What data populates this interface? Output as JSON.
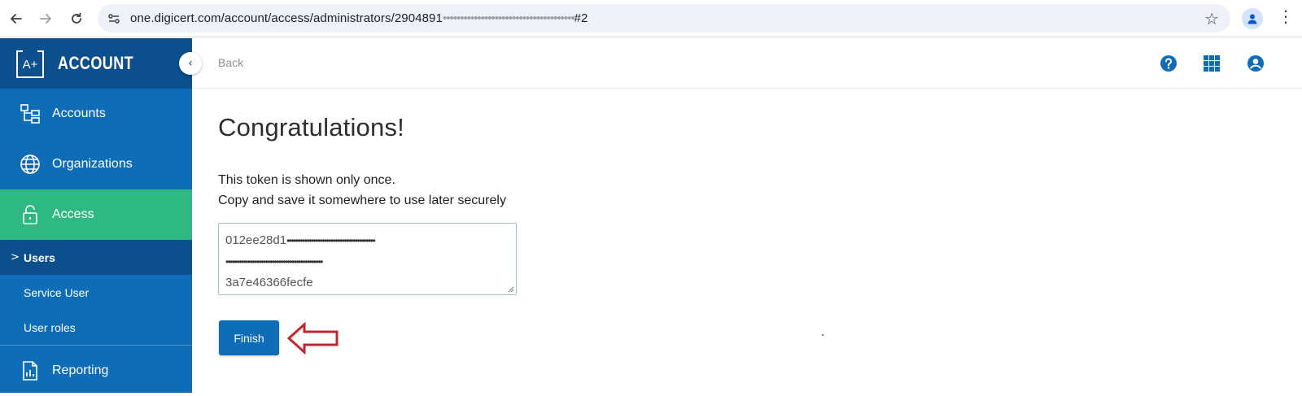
{
  "browser": {
    "url_prefix": "one.digicert.com/account/access/administrators/2904891",
    "url_masked": "••••••••••••••••••••••••••••••••••••••",
    "url_suffix": "#2",
    "back_icon": "arrow-left-icon",
    "forward_icon": "arrow-right-icon",
    "reload_icon": "reload-icon"
  },
  "sidebar": {
    "brand_badge": "A+",
    "brand_title": "ACCOUNT",
    "collapse_icon": "chevron-left-icon",
    "items": [
      {
        "label": "Accounts",
        "icon": "hierarchy-icon"
      },
      {
        "label": "Organizations",
        "icon": "globe-icon"
      },
      {
        "label": "Access",
        "icon": "lock-icon",
        "active": true
      }
    ],
    "subitems": [
      {
        "label": "Users",
        "current": true,
        "marker": ">"
      },
      {
        "label": "Service User"
      },
      {
        "label": "User roles"
      }
    ],
    "bottom_item": {
      "label": "Reporting",
      "icon": "report-icon"
    }
  },
  "topbar": {
    "back_label": "Back",
    "icons": [
      "help-icon",
      "apps-grid-icon",
      "account-icon"
    ]
  },
  "main": {
    "title": "Congratulations!",
    "message_line1": "This token is shown only once.",
    "message_line2": "Copy and save it somewhere to use later securely",
    "token": {
      "line1_visible": "012ee28d1",
      "line1_masked": "••••••••••••••••••••••••••••••••••••••••",
      "line2_masked": "••••••••••••••••••••••••••••••••••••••••••••",
      "line3_visible": "3a7e46366fecfe"
    },
    "finish_label": "Finish"
  },
  "colors": {
    "sidebar_bg": "#0f6db8",
    "sidebar_dark": "#0b4f8c",
    "active_green": "#2fb982",
    "annotation_red": "#c0262d"
  }
}
